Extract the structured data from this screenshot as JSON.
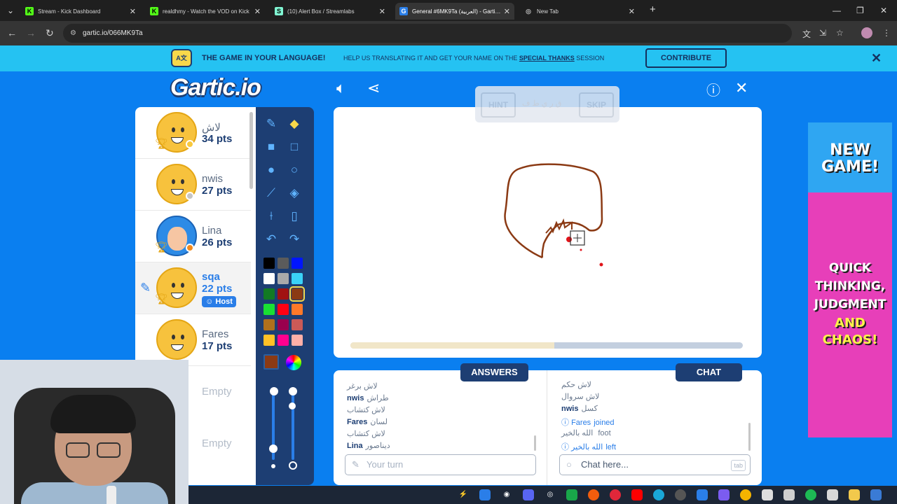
{
  "browser": {
    "tabs": [
      {
        "title": "Stream - Kick Dashboard",
        "fav": "K",
        "color": "#53fc18"
      },
      {
        "title": "realdhmy - Watch the VOD on Kick",
        "fav": "K",
        "color": "#53fc18"
      },
      {
        "title": "(10) Alert Box / Streamlabs",
        "fav": "S",
        "color": "#80f5d2"
      },
      {
        "title": "General #6MK9Ta (العربية) - Gartic.io",
        "fav": "G",
        "color": "#2a7ee8"
      },
      {
        "title": "New Tab",
        "fav": "◎",
        "color": "#888888"
      }
    ],
    "url": "gartic.io/066MK9Ta"
  },
  "banner": {
    "headline": "THE GAME IN YOUR LANGUAGE!",
    "text_before": "HELP US TRANSLATING IT AND GET YOUR NAME ON THE",
    "text_link": "SPECIAL THANKS",
    "text_after": "SESSION",
    "button": "CONTRIBUTE"
  },
  "game": {
    "logo": "Gartic.io",
    "hint_label": "HINT",
    "skip_label": "SKIP",
    "hint_word": "ق ر ي ط ف",
    "progress": 0.52
  },
  "players": [
    {
      "name": "لاش",
      "pts": "34 pts",
      "status": "#f8c93e"
    },
    {
      "name": "nwis",
      "pts": "27 pts",
      "status": "#c5c5c5"
    },
    {
      "name": "Lina",
      "pts": "26 pts",
      "status": "#f28a1e"
    },
    {
      "name": "sqa",
      "pts": "22 pts",
      "host": "Host"
    },
    {
      "name": "Fares",
      "pts": "17 pts"
    }
  ],
  "empty_slots": [
    "Empty",
    "Empty"
  ],
  "answers": {
    "title": "ANSWERS",
    "messages": [
      {
        "who": "",
        "text": "لاش برغر"
      },
      {
        "who": "nwis",
        "text": "طراش"
      },
      {
        "who": "",
        "text": "لاش كتشاب"
      },
      {
        "who": "Fares",
        "text": "لسان"
      },
      {
        "who": "",
        "text": "لاش كتشاب"
      },
      {
        "who": "Lina",
        "text": "ديناصور"
      }
    ],
    "placeholder": "Your turn"
  },
  "chat": {
    "title": "CHAT",
    "messages": [
      {
        "who": "",
        "text": "لاش حكم"
      },
      {
        "who": "",
        "text": "لاش سروال"
      },
      {
        "who": "nwis",
        "text": "كسل"
      },
      {
        "who": "Fares",
        "text": "joined",
        "info": true
      },
      {
        "who": "",
        "text": "الله بالخير foot"
      },
      {
        "who": "الله بالخير",
        "text": "left",
        "info": true
      }
    ],
    "placeholder": "Chat here...",
    "tab_key": "tab"
  },
  "ad": {
    "line1": "NEW GAME!",
    "line2": "QUICK THINKING, JUDGMENT",
    "line3": "AND CHAOS!"
  },
  "colors": {
    "accent": "#0a7ff0",
    "navy": "#1d3e73",
    "banner": "#25c2f2",
    "brush": "#8b3a14"
  }
}
